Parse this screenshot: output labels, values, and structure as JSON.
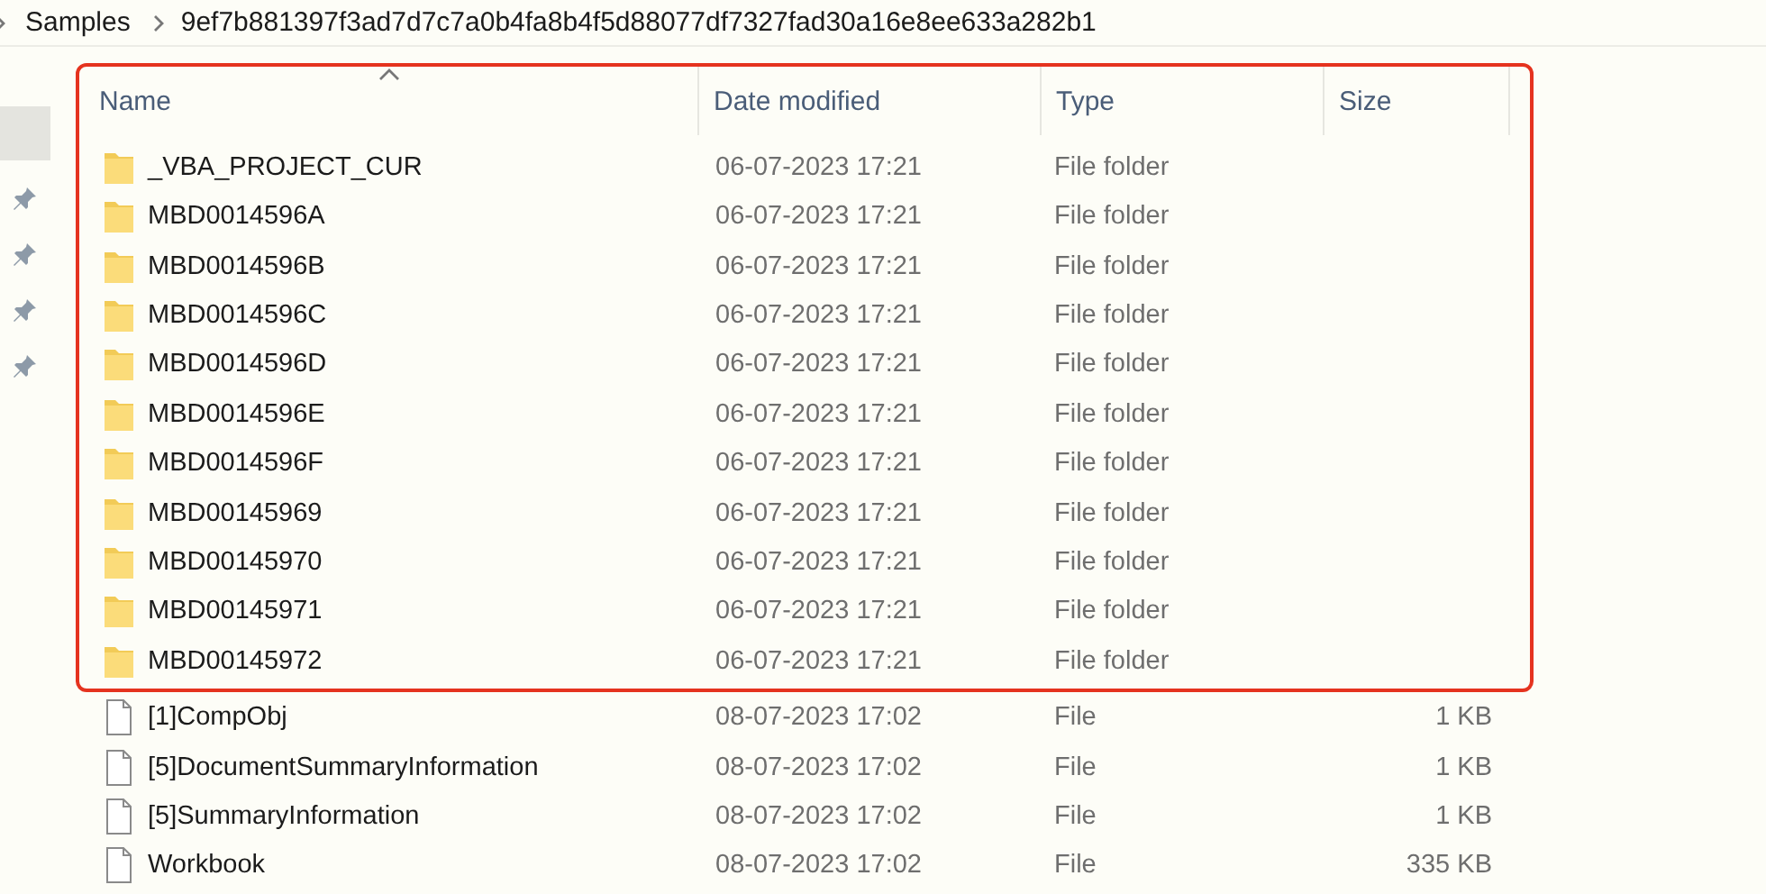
{
  "breadcrumb": [
    "Samples",
    "9ef7b881397f3ad7d7c7a0b4fa8b4f5d88077df7327fad30a16e8ee633a282b1"
  ],
  "columns": [
    {
      "label": "Name",
      "sorted": true
    },
    {
      "label": "Date modified",
      "sorted": false
    },
    {
      "label": "Type",
      "sorted": false
    },
    {
      "label": "Size",
      "sorted": false
    }
  ],
  "highlight_frame": {
    "rows": [
      {
        "name": "_VBA_PROJECT_CUR",
        "date": "06-07-2023 17:21",
        "type": "File folder",
        "kind": "folder"
      },
      {
        "name": "MBD0014596A",
        "date": "06-07-2023 17:21",
        "type": "File folder",
        "kind": "folder"
      },
      {
        "name": "MBD0014596B",
        "date": "06-07-2023 17:21",
        "type": "File folder",
        "kind": "folder"
      },
      {
        "name": "MBD0014596C",
        "date": "06-07-2023 17:21",
        "type": "File folder",
        "kind": "folder"
      },
      {
        "name": "MBD0014596D",
        "date": "06-07-2023 17:21",
        "type": "File folder",
        "kind": "folder"
      },
      {
        "name": "MBD0014596E",
        "date": "06-07-2023 17:21",
        "type": "File folder",
        "kind": "folder"
      },
      {
        "name": "MBD0014596F",
        "date": "06-07-2023 17:21",
        "type": "File folder",
        "kind": "folder"
      },
      {
        "name": "MBD00145969",
        "date": "06-07-2023 17:21",
        "type": "File folder",
        "kind": "folder"
      },
      {
        "name": "MBD00145970",
        "date": "06-07-2023 17:21",
        "type": "File folder",
        "kind": "folder"
      },
      {
        "name": "MBD00145971",
        "date": "06-07-2023 17:21",
        "type": "File folder",
        "kind": "folder"
      },
      {
        "name": "MBD00145972",
        "date": "06-07-2023 17:21",
        "type": "File folder",
        "kind": "folder"
      }
    ]
  },
  "rows": [
    {
      "name": "[1]CompObj",
      "date": "08-07-2023 17:02",
      "type": "File",
      "size": "1 KB",
      "kind": "file"
    },
    {
      "name": "[5]DocumentSummaryInformation",
      "date": "08-07-2023 17:02",
      "type": "File",
      "size": "1 KB",
      "kind": "file"
    },
    {
      "name": "[5]SummaryInformation",
      "date": "08-07-2023 17:02",
      "type": "File",
      "size": "1 KB",
      "kind": "file"
    },
    {
      "name": "Workbook",
      "date": "08-07-2023 17:02",
      "type": "File",
      "size": "335 KB",
      "kind": "file"
    }
  ]
}
